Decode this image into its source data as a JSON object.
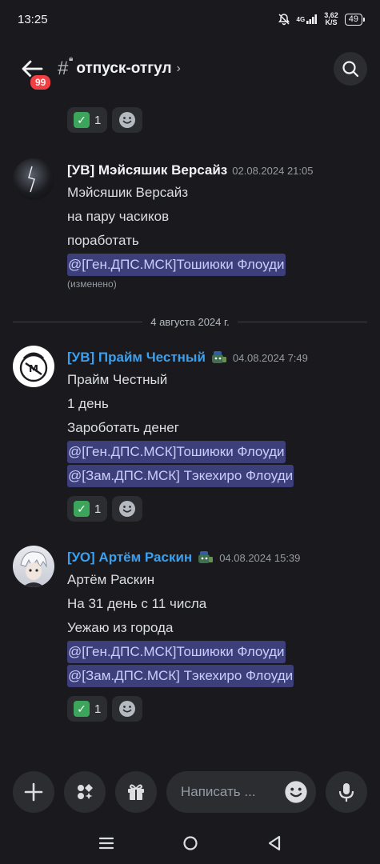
{
  "status": {
    "time": "13:25",
    "network": "4G",
    "speed_value": "3,62",
    "speed_unit": "K/S",
    "battery": "49"
  },
  "header": {
    "badge": "99",
    "channel_name": "отпуск-отгул",
    "channel_icon": "hashtag-lock-icon"
  },
  "top_reaction": {
    "emoji": "white-check-mark",
    "count": "1"
  },
  "messages": [
    {
      "author": "[УВ] Мэйсяшик Версайз",
      "author_color": "#f2f3f5",
      "timestamp": "02.08.2024 21:05",
      "lines": [
        "Мэйсяшик Версайз",
        "на пару часиков",
        "поработать"
      ],
      "mentions": [
        "@[Ген.ДПС.МСК]Тошиюки Флоуди"
      ],
      "edited": "(изменено)"
    },
    {
      "author": "[УВ] Прайм Честный",
      "author_color": "#3aa0f0",
      "timestamp": "04.08.2024 7:49",
      "lines": [
        "Прайм Честный",
        "1 день",
        "Зароботать денег"
      ],
      "mentions": [
        "@[Ген.ДПС.МСК]Тошиюки Флоуди",
        "@[Зам.ДПС.МСК] Тэкехиро Флоуди"
      ],
      "reaction": {
        "emoji": "white-check-mark",
        "count": "1"
      }
    },
    {
      "author": "[УО] Артём Раскин",
      "author_color": "#3aa0f0",
      "timestamp": "04.08.2024 15:39",
      "lines": [
        "Артём Раскин",
        "На 31 день с 11 числа",
        "Уежаю из города"
      ],
      "mentions": [
        "@[Ген.ДПС.МСК]Тошиюки Флоуди",
        "@[Зам.ДПС.МСК] Тэкехиро Флоуди"
      ],
      "reaction": {
        "emoji": "white-check-mark",
        "count": "1"
      }
    }
  ],
  "date_divider": "4 августа 2024 г.",
  "composer": {
    "placeholder": "Написать ..."
  },
  "colors": {
    "background": "#1a1a1e",
    "mention_bg": "#3c3f7a",
    "accent": "#3aa0f0"
  }
}
